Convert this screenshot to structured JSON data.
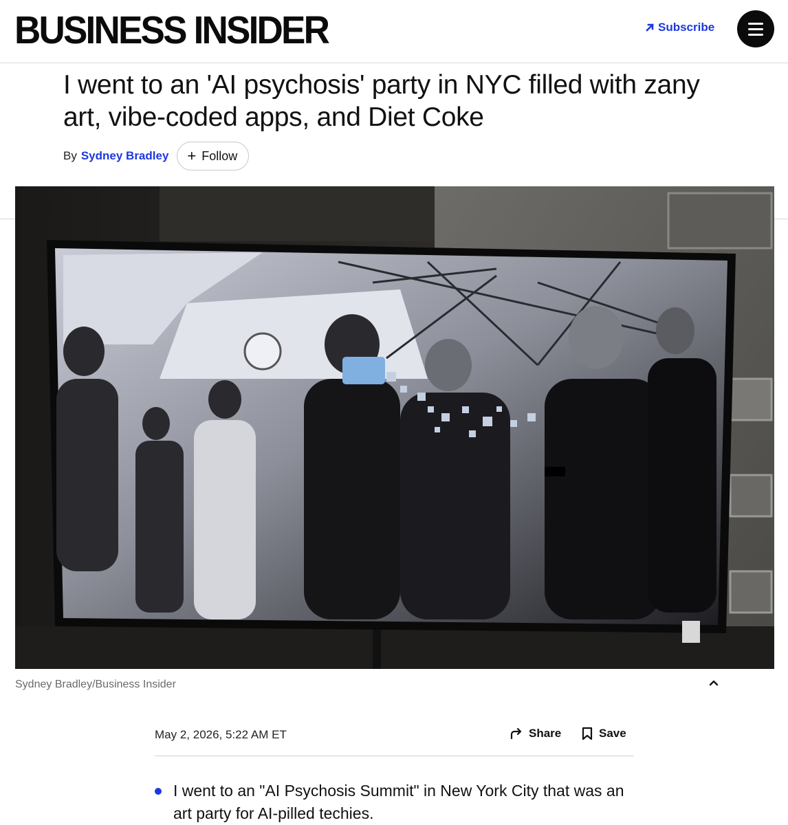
{
  "header": {
    "logo": "BUSINESS INSIDER",
    "subscribe_label": "Subscribe",
    "menu_icon": "hamburger-menu-icon"
  },
  "article": {
    "headline": "I went to an 'AI psychosis' party in NYC filled with zany art, vibe-coded apps, and Diet Coke",
    "by_label": "By",
    "author": "Sydney Bradley",
    "follow_label": "Follow",
    "photo_credit": "Sydney Bradley/Business Insider",
    "date": "May 2, 2026, 5:22 AM ET",
    "share_label": "Share",
    "save_label": "Save",
    "bullets": [
      "I went to an \"AI Psychosis Summit\" in New York City that was an art party for AI-pilled techies."
    ]
  },
  "colors": {
    "accent": "#1d38e0",
    "text": "#111111",
    "muted": "#6a6a6a",
    "menu_bg": "#0b0b0b"
  }
}
